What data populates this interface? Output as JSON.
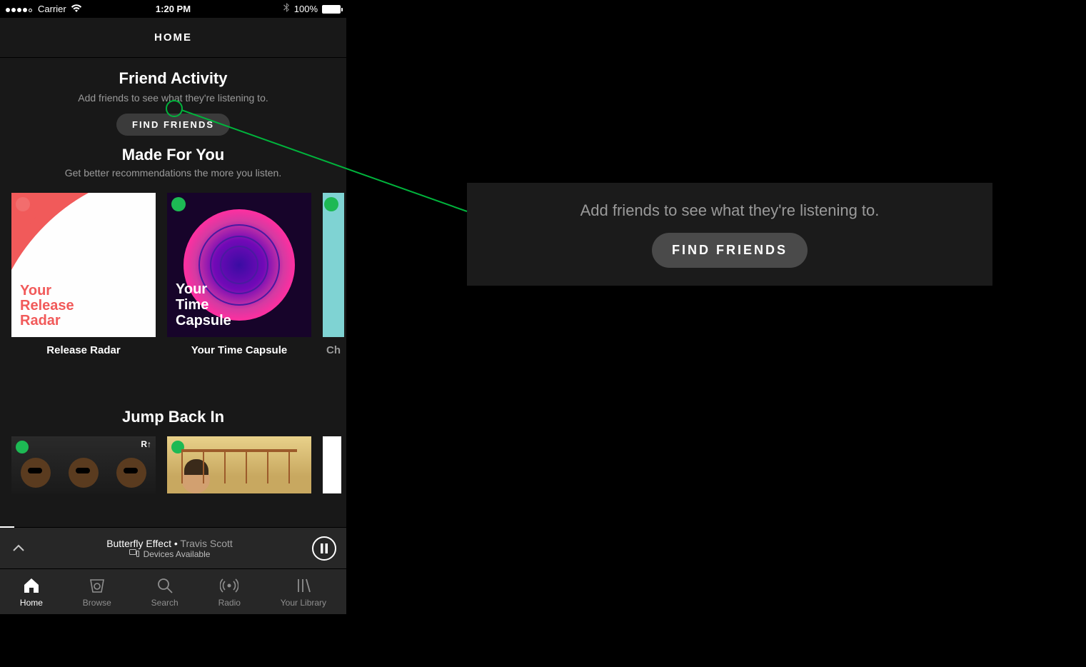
{
  "status_bar": {
    "carrier": "Carrier",
    "time": "1:20 PM",
    "battery_pct": "100%"
  },
  "header": {
    "title": "HOME"
  },
  "friend_activity": {
    "title": "Friend Activity",
    "subtitle": "Add friends to see what they're listening to.",
    "button": "FIND FRIENDS"
  },
  "made_for_you": {
    "title": "Made For You",
    "subtitle": "Get better recommendations the more you listen.",
    "cards": [
      {
        "cover_text": "Your Release Radar",
        "label": "Release Radar"
      },
      {
        "cover_text": "Your Time Capsule",
        "label": "Your Time Capsule"
      },
      {
        "cover_text": "",
        "label": "Ch"
      }
    ]
  },
  "jump_back_in": {
    "title": "Jump Back In"
  },
  "now_playing": {
    "track": "Butterfly Effect",
    "separator": " • ",
    "artist": "Travis Scott",
    "devices": "Devices Available"
  },
  "tabs": [
    {
      "label": "Home"
    },
    {
      "label": "Browse"
    },
    {
      "label": "Search"
    },
    {
      "label": "Radio"
    },
    {
      "label": "Your Library"
    }
  ],
  "callout": {
    "subtitle": "Add friends to see what they're listening to.",
    "button": "FIND FRIENDS"
  }
}
